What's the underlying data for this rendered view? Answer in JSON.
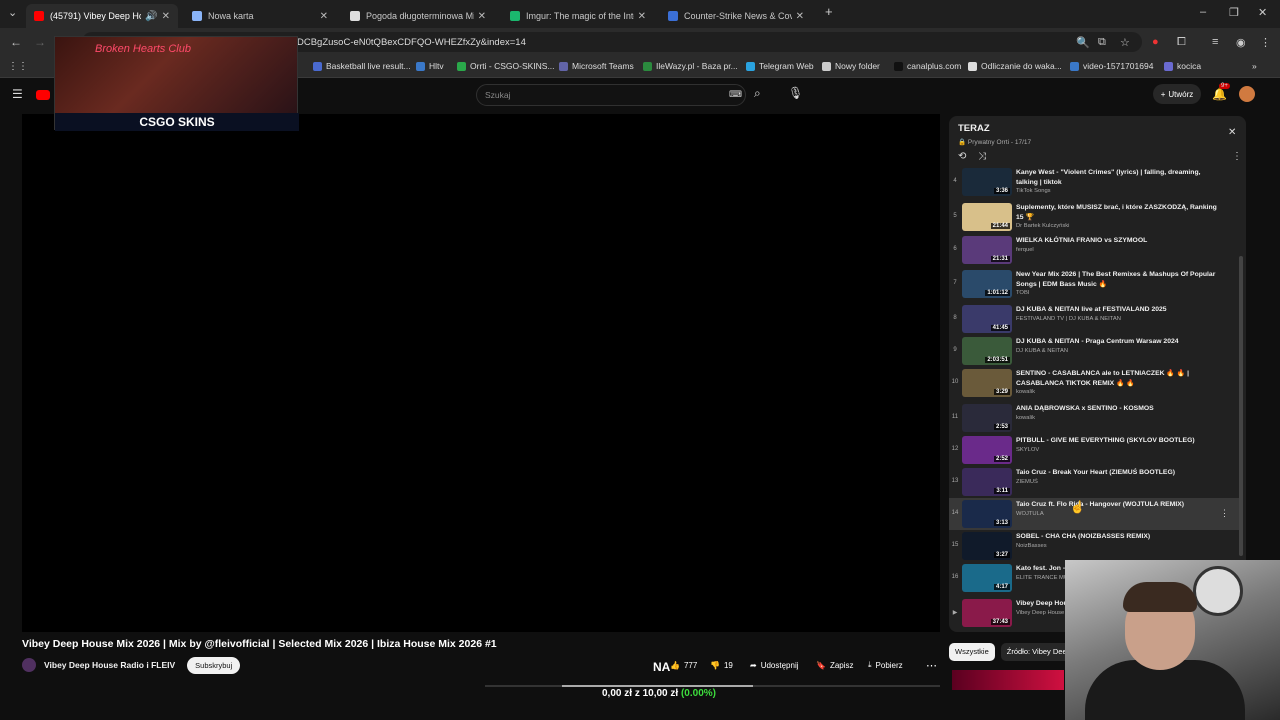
{
  "browser": {
    "tabs": [
      {
        "title": "(45791) Vibey Deep House",
        "color": "#ff0000",
        "active": true,
        "audio": true
      },
      {
        "title": "Nowa karta",
        "color": "#8ab4f8",
        "active": false,
        "audio": false
      },
      {
        "title": "Pogoda długoterminowa Międz",
        "color": "#dddddd",
        "active": false,
        "audio": false
      },
      {
        "title": "Imgur: The magic of the Interne",
        "color": "#1bb76e",
        "active": false,
        "audio": false
      },
      {
        "title": "Counter-Strike News & Covera",
        "color": "#3b6fd6",
        "active": false,
        "audio": false
      }
    ],
    "new_tab": "+",
    "url": "...youtube.com/watch?v=8a7...&list=PLDCBgZusoC-eN0tQBexCDFQO-WHEZfxZy&index=14",
    "url_visible": "DCBgZusoC-eN0tQBexCDFQO-WHEZfxZy&index=14",
    "bookmarks": [
      {
        "label": "Basketball live result...",
        "color": "#4a6ad0"
      },
      {
        "label": "Hltv",
        "color": "#3a78c8"
      },
      {
        "label": "Orrti - CSGO-SKINS...",
        "color": "#2aa84a"
      },
      {
        "label": "Microsoft Teams",
        "color": "#6264a7"
      },
      {
        "label": "IleWazy.pl - Baza pr...",
        "color": "#2b8a3e"
      },
      {
        "label": "Telegram Web",
        "color": "#2aa3e0"
      },
      {
        "label": "Nowy folder",
        "color": "#cccccc"
      },
      {
        "label": "canalplus.com",
        "color": "#111111"
      },
      {
        "label": "Odliczanie do waka...",
        "color": "#dddddd"
      },
      {
        "label": "video-1571701694",
        "color": "#3a78c8"
      },
      {
        "label": "kocica",
        "color": "#6a6ad0"
      }
    ]
  },
  "youtube": {
    "search_placeholder": "Szukaj",
    "create_label": "Utwórz",
    "notif_badge": "9+"
  },
  "overlay": {
    "neon": "Broken Hearts Club",
    "brand": "CSGO SKINS"
  },
  "video": {
    "title": "Vibey Deep House Mix 2026 | Mix by @fleivofficial | Selected Mix 2026 | Ibiza House Mix 2026 #1",
    "channel": "Vibey Deep House Radio i FLEIV",
    "subscribe": "Subskrybuj",
    "likes": "777",
    "dislikes": "19",
    "share": "Udostępnij",
    "save": "Zapisz",
    "download": "Pobierz",
    "na_label": "NA",
    "progress_fraction": 0.42
  },
  "money": {
    "prefix": "0,00 zł",
    "mid": "z",
    "target": "10,00 zł",
    "pct": "(0.00%)"
  },
  "playlist": {
    "title": "TERAZ",
    "meta": "Prywatny Orrti - 17/17",
    "items": [
      {
        "n": "4",
        "title": "Kanye West - \"Violent Crimes\" (lyrics) | falling, dreaming, talking | tiktok",
        "channel": "TikTok Songs",
        "dur": "3:36",
        "color": "#1a2a3a"
      },
      {
        "n": "5",
        "title": "Suplementy, które MUSISZ brać, i które ZASZKODZĄ, Ranking 15 🏆",
        "channel": "Dr Bartek Kulczyński",
        "dur": "21:44",
        "color": "#d8c08a"
      },
      {
        "n": "6",
        "title": "WIELKA KŁÓTNIA FRANIO vs SZYMOOL",
        "channel": "ferquel",
        "dur": "21:31",
        "color": "#5a3a7a"
      },
      {
        "n": "7",
        "title": "New Year Mix 2026 | The Best Remixes & Mashups Of Popular Songs | EDM Bass Music 🔥",
        "channel": "TOBI",
        "dur": "1:01:12",
        "color": "#2a4a6a"
      },
      {
        "n": "8",
        "title": "DJ KUBA & NEITAN live at FESTIVALAND 2025",
        "channel": "FESTIVALAND TV | DJ KUBA & NEITAN",
        "dur": "41:45",
        "color": "#3a3a6a"
      },
      {
        "n": "9",
        "title": "DJ KUBA & NEITAN - Praga Centrum Warsaw 2024",
        "channel": "DJ KUBA & NEITAN",
        "dur": "2:03:51",
        "color": "#3a5a3a"
      },
      {
        "n": "10",
        "title": "SENTINO - CASABLANCA ale to LETNIACZEK 🔥 🔥 | CASABLANCA TIKTOK REMIX 🔥 🔥",
        "channel": "kowalik",
        "dur": "3:29",
        "color": "#6a5a3a"
      },
      {
        "n": "11",
        "title": "ANIA DĄBROWSKA x SENTINO - KOSMOS",
        "channel": "kowalik",
        "dur": "2:53",
        "color": "#2a2a3a"
      },
      {
        "n": "12",
        "title": "PITBULL - GIVE ME EVERYTHING (SKYLOV BOOTLEG)",
        "channel": "SKYLOV",
        "dur": "2:52",
        "color": "#6a2a8a"
      },
      {
        "n": "13",
        "title": "Taio Cruz - Break Your Heart (ZIEMUŚ BOOTLEG)",
        "channel": "ZIEMUŚ",
        "dur": "3:11",
        "color": "#3a2a5a"
      },
      {
        "n": "14",
        "title": "Taio Cruz ft. Flo Rida - Hangover (WOJTULA REMIX)",
        "channel": "WOJTULA",
        "dur": "3:13",
        "color": "#1a2a4a",
        "current": true
      },
      {
        "n": "15",
        "title": "SOBEL - CHA CHA (NOIZBASSES REMIX)",
        "channel": "NoizBasses",
        "dur": "3:27",
        "color": "#101a2a"
      },
      {
        "n": "16",
        "title": "Kato fest. Jon - Vale) TRANCE (",
        "channel": "ELITE TRANCE MU",
        "dur": "4:17",
        "color": "#1a6a8a"
      },
      {
        "n": "▶",
        "title": "Vibey Deep Hou Mix 2026 | Ibiza",
        "channel": "Vibey Deep House",
        "dur": "37:43",
        "color": "#8a1a4a"
      }
    ]
  },
  "chips": [
    "Wszystkie",
    "Źródło: Vibey Deep"
  ]
}
